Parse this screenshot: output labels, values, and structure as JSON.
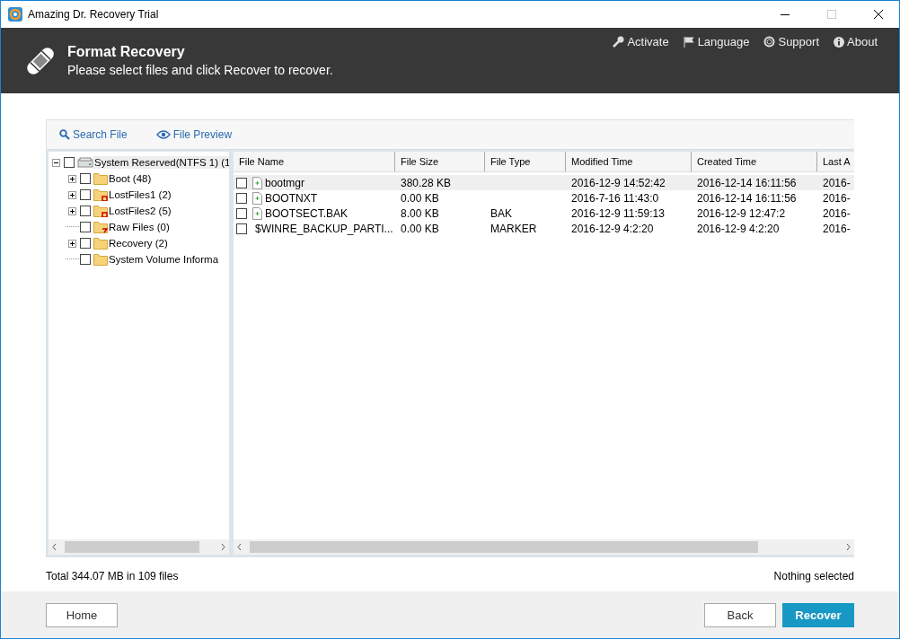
{
  "window": {
    "title": "Amazing Dr. Recovery Trial"
  },
  "header": {
    "title": "Format Recovery",
    "subtitle": "Please select files and click Recover to recover.",
    "links": [
      "Activate",
      "Language",
      "Support",
      "About"
    ]
  },
  "toolbar": [
    "Search File",
    "File Preview"
  ],
  "tree": [
    {
      "label": "System Reserved(NTFS 1) (1",
      "kind": "drive",
      "expanded": true,
      "checked": false,
      "selected": true,
      "children": [
        {
          "label": "Boot (48)",
          "kind": "folder",
          "expanded": false,
          "checked": false,
          "selected": false
        },
        {
          "label": "LostFiles1 (2)",
          "kind": "lost-folder",
          "expanded": false,
          "checked": false,
          "selected": false
        },
        {
          "label": "LostFiles2 (5)",
          "kind": "lost-folder",
          "expanded": false,
          "checked": false,
          "selected": false
        },
        {
          "label": "Raw Files (0)",
          "kind": "raw-folder",
          "checked": false,
          "selected": false
        },
        {
          "label": "Recovery (2)",
          "kind": "folder",
          "expanded": false,
          "checked": false,
          "selected": false
        },
        {
          "label": "System Volume Informa",
          "kind": "folder",
          "checked": false,
          "selected": false
        }
      ]
    }
  ],
  "table": {
    "columns": [
      "File Name",
      "File Size",
      "File Type",
      "Modified Time",
      "Created Time",
      "Last A"
    ],
    "rows": [
      {
        "selected": true,
        "checked": false,
        "cells": [
          "bootmgr",
          "380.28 KB",
          "",
          "2016-12-9 14:52:42",
          "2016-12-14 16:11:56",
          "2016-"
        ]
      },
      {
        "selected": false,
        "checked": false,
        "cells": [
          "BOOTNXT",
          "0.00 KB",
          "",
          "2016-7-16 11:43:0",
          "2016-12-14 16:11:56",
          "2016-"
        ]
      },
      {
        "selected": false,
        "checked": false,
        "cells": [
          "BOOTSECT.BAK",
          "8.00 KB",
          "BAK",
          "2016-12-9 11:59:13",
          "2016-12-9 12:47:2",
          "2016-"
        ]
      },
      {
        "selected": false,
        "checked": false,
        "cells": [
          "$WINRE_BACKUP_PARTI...",
          "0.00 KB",
          "MARKER",
          "2016-12-9 4:2:20",
          "2016-12-9 4:2:20",
          "2016-"
        ]
      }
    ]
  },
  "status": {
    "left": "Total 344.07 MB in 109 files",
    "right": "Nothing selected"
  },
  "footer": {
    "left_button": "Home",
    "buttons": [
      {
        "label": "Back",
        "kind": "secondary"
      },
      {
        "label": "Recover",
        "kind": "primary"
      }
    ]
  }
}
